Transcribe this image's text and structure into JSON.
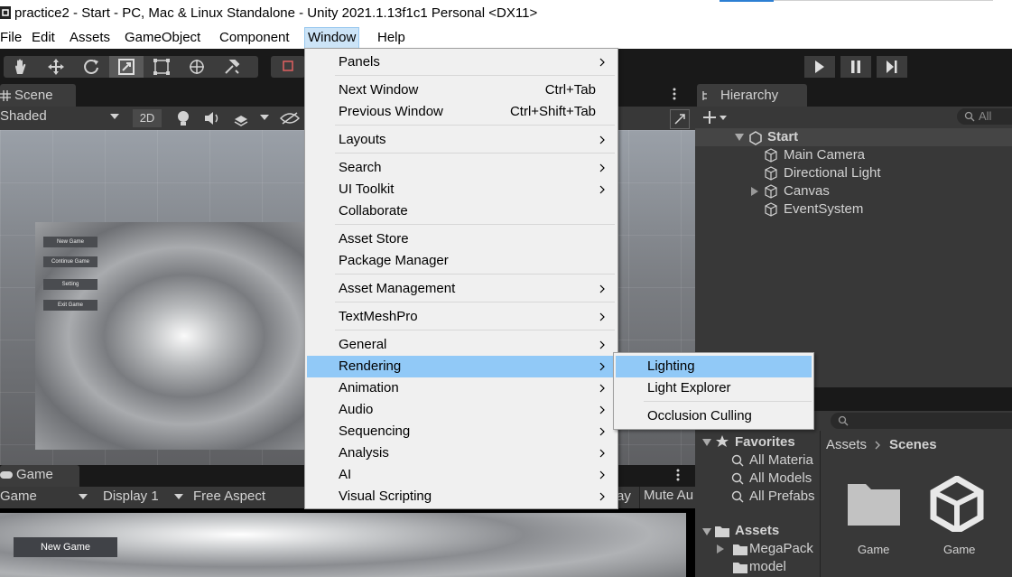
{
  "window": {
    "title": "practice2 - Start - PC, Mac & Linux Standalone - Unity 2021.1.13f1c1 Personal <DX11>"
  },
  "menubar": {
    "items": [
      "File",
      "Edit",
      "Assets",
      "GameObject",
      "Component",
      "Window",
      "Help"
    ],
    "active": "Window"
  },
  "scene": {
    "tab_label": "Scene",
    "shading_mode": "Shaded",
    "toggle_2d": "2D",
    "ui_buttons": [
      "New Game",
      "Continue Game",
      "Setting",
      "Exit Game"
    ]
  },
  "game": {
    "tab_label": "Game",
    "mode": "Game",
    "display": "Display 1",
    "aspect": "Free Aspect",
    "play_partial": "ay",
    "mute_partial": "Mute Au",
    "new_game_label": "New Game"
  },
  "hierarchy": {
    "tab_label": "Hierarchy",
    "search_placeholder": "All",
    "scene_name": "Start",
    "objects": [
      "Main Camera",
      "Directional Light",
      "Canvas",
      "EventSystem"
    ]
  },
  "project": {
    "favorites_label": "Favorites",
    "favorites": [
      "All Materia",
      "All Models",
      "All Prefabs"
    ],
    "assets_label": "Assets",
    "assets_children": [
      "MegaPack",
      "model"
    ],
    "breadcrumb": [
      "Assets",
      "Scenes"
    ],
    "items": [
      {
        "name": "Game",
        "icon": "folder-icon"
      },
      {
        "name": "Game",
        "icon": "unity-scene-icon"
      }
    ]
  },
  "window_menu": {
    "items": [
      {
        "label": "Panels",
        "shortcut": "",
        "submenu": true
      },
      {
        "label": "Next Window",
        "shortcut": "Ctrl+Tab",
        "submenu": false
      },
      {
        "label": "Previous Window",
        "shortcut": "Ctrl+Shift+Tab",
        "submenu": false
      },
      {
        "label": "Layouts",
        "shortcut": "",
        "submenu": true
      },
      {
        "label": "Search",
        "shortcut": "",
        "submenu": true
      },
      {
        "label": "UI Toolkit",
        "shortcut": "",
        "submenu": true
      },
      {
        "label": "Collaborate",
        "shortcut": "",
        "submenu": false
      },
      {
        "label": "Asset Store",
        "shortcut": "",
        "submenu": false
      },
      {
        "label": "Package Manager",
        "shortcut": "",
        "submenu": false
      },
      {
        "label": "Asset Management",
        "shortcut": "",
        "submenu": true
      },
      {
        "label": "TextMeshPro",
        "shortcut": "",
        "submenu": true
      },
      {
        "label": "General",
        "shortcut": "",
        "submenu": true
      },
      {
        "label": "Rendering",
        "shortcut": "",
        "submenu": true
      },
      {
        "label": "Animation",
        "shortcut": "",
        "submenu": true
      },
      {
        "label": "Audio",
        "shortcut": "",
        "submenu": true
      },
      {
        "label": "Sequencing",
        "shortcut": "",
        "submenu": true
      },
      {
        "label": "Analysis",
        "shortcut": "",
        "submenu": true
      },
      {
        "label": "AI",
        "shortcut": "",
        "submenu": true
      },
      {
        "label": "Visual Scripting",
        "shortcut": "",
        "submenu": true
      }
    ],
    "highlighted": "Rendering"
  },
  "rendering_submenu": {
    "items": [
      "Lighting",
      "Light Explorer",
      "Occlusion Culling"
    ],
    "highlighted": "Lighting"
  },
  "colors": {
    "menu_highlight": "#91c9f7",
    "editor_dark": "#383838",
    "editor_background": "#191919"
  }
}
